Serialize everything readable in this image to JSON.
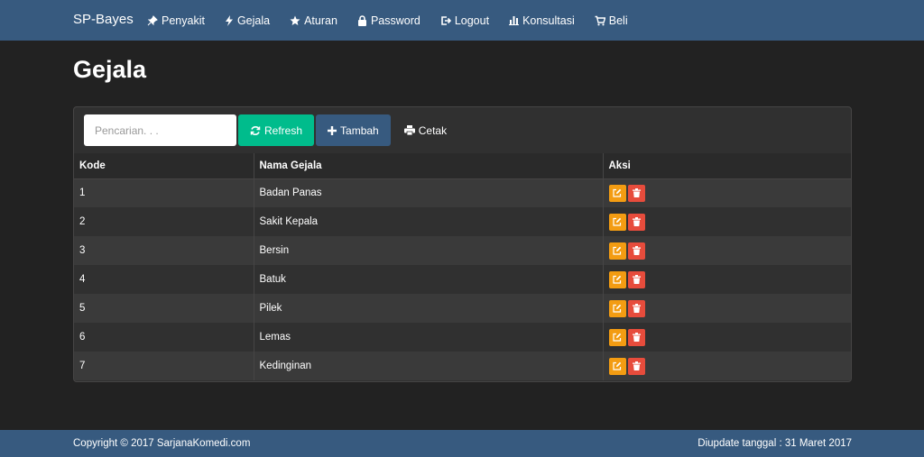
{
  "nav": {
    "brand": "SP-Bayes",
    "items": [
      {
        "label": "Penyakit",
        "icon": "pushpin-icon"
      },
      {
        "label": "Gejala",
        "icon": "flash-icon"
      },
      {
        "label": "Aturan",
        "icon": "star-icon"
      },
      {
        "label": "Password",
        "icon": "lock-icon"
      },
      {
        "label": "Logout",
        "icon": "logout-icon"
      },
      {
        "label": "Konsultasi",
        "icon": "bar-chart-icon"
      },
      {
        "label": "Beli",
        "icon": "cart-icon"
      }
    ]
  },
  "page": {
    "title": "Gejala"
  },
  "toolbar": {
    "search_placeholder": "Pencarian. . .",
    "search_value": "",
    "refresh_label": "Refresh",
    "add_label": "Tambah",
    "print_label": "Cetak"
  },
  "table": {
    "headers": [
      "Kode",
      "Nama Gejala",
      "Aksi"
    ],
    "rows": [
      {
        "kode": "1",
        "nama": "Badan Panas"
      },
      {
        "kode": "2",
        "nama": "Sakit Kepala"
      },
      {
        "kode": "3",
        "nama": "Bersin"
      },
      {
        "kode": "4",
        "nama": "Batuk"
      },
      {
        "kode": "5",
        "nama": "Pilek"
      },
      {
        "kode": "6",
        "nama": "Lemas"
      },
      {
        "kode": "7",
        "nama": "Kedinginan"
      }
    ]
  },
  "footer": {
    "copyright": "Copyright © 2017 SarjanaKomedi.com",
    "updated": "Diupdate tanggal : 31 Maret 2017"
  },
  "colors": {
    "navbar": "#375a7f",
    "background": "#222222",
    "success": "#00bc8c",
    "warning": "#f39c12",
    "danger": "#e74c3c"
  }
}
